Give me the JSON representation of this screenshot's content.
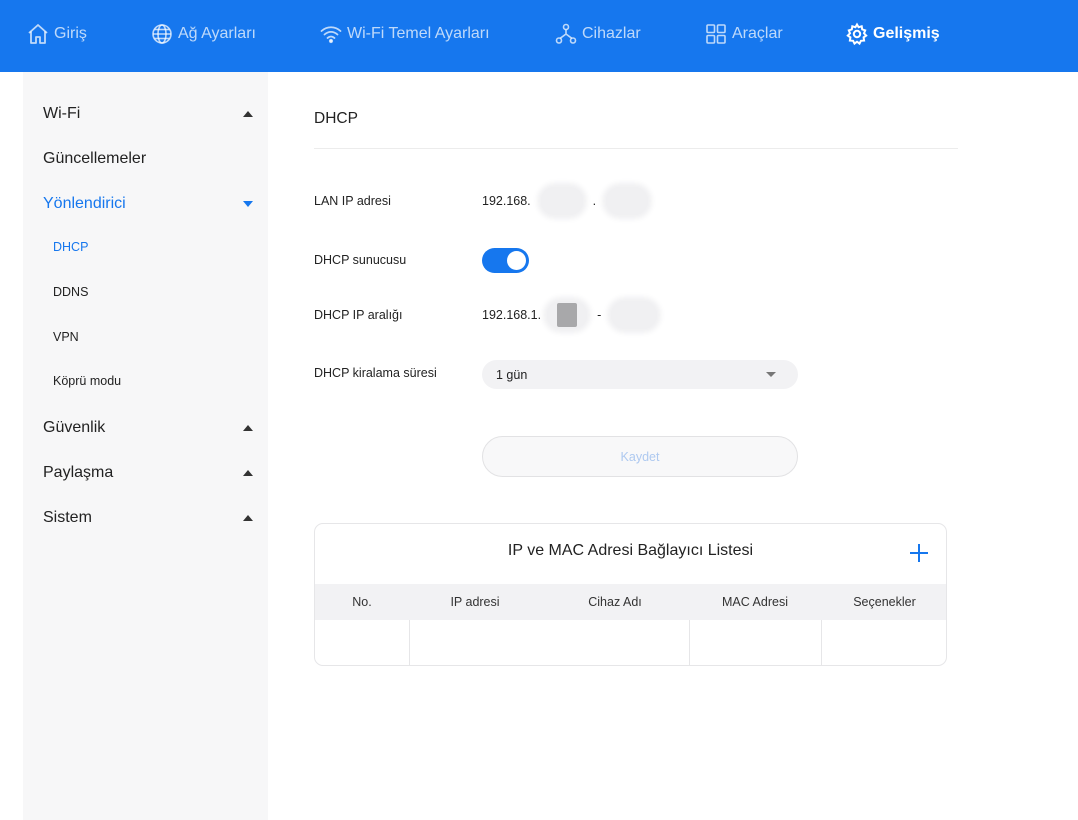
{
  "nav": {
    "items": [
      {
        "label": "Giriş",
        "icon": "home-icon"
      },
      {
        "label": "Ağ Ayarları",
        "icon": "globe-icon"
      },
      {
        "label": "Wi-Fi Temel Ayarları",
        "icon": "wifi-icon"
      },
      {
        "label": "Cihazlar",
        "icon": "devices-icon"
      },
      {
        "label": "Araçlar",
        "icon": "apps-grid-icon"
      },
      {
        "label": "Gelişmiş",
        "icon": "gear-icon",
        "active": true
      }
    ]
  },
  "sidebar": {
    "items": [
      {
        "label": "Wi-Fi"
      },
      {
        "label": "Güncellemeler"
      },
      {
        "label": "Yönlendirici"
      },
      {
        "label": "DHCP"
      },
      {
        "label": "DDNS"
      },
      {
        "label": "VPN"
      },
      {
        "label": "Köprü modu"
      },
      {
        "label": "Güvenlik"
      },
      {
        "label": "Paylaşma"
      },
      {
        "label": "Sistem"
      }
    ]
  },
  "page": {
    "title": "DHCP"
  },
  "form": {
    "lan_ip_label": "LAN IP adresi",
    "lan_ip_prefix": "192.168.",
    "lan_ip_separator": ".",
    "dhcp_server_label": "DHCP sunucusu",
    "dhcp_server_on": true,
    "dhcp_range_label": "DHCP IP aralığı",
    "dhcp_range_prefix": "192.168.1.",
    "dhcp_range_separator": "-",
    "lease_label": "DHCP kiralama süresi",
    "lease_value": "1 gün",
    "save_label": "Kaydet"
  },
  "binding_list": {
    "title": "IP ve MAC Adresi Bağlayıcı Listesi",
    "columns": [
      "No.",
      "IP adresi",
      "Cihaz Adı",
      "MAC Adresi",
      "Seçenekler"
    ]
  },
  "colors": {
    "accent": "#1677ee"
  }
}
